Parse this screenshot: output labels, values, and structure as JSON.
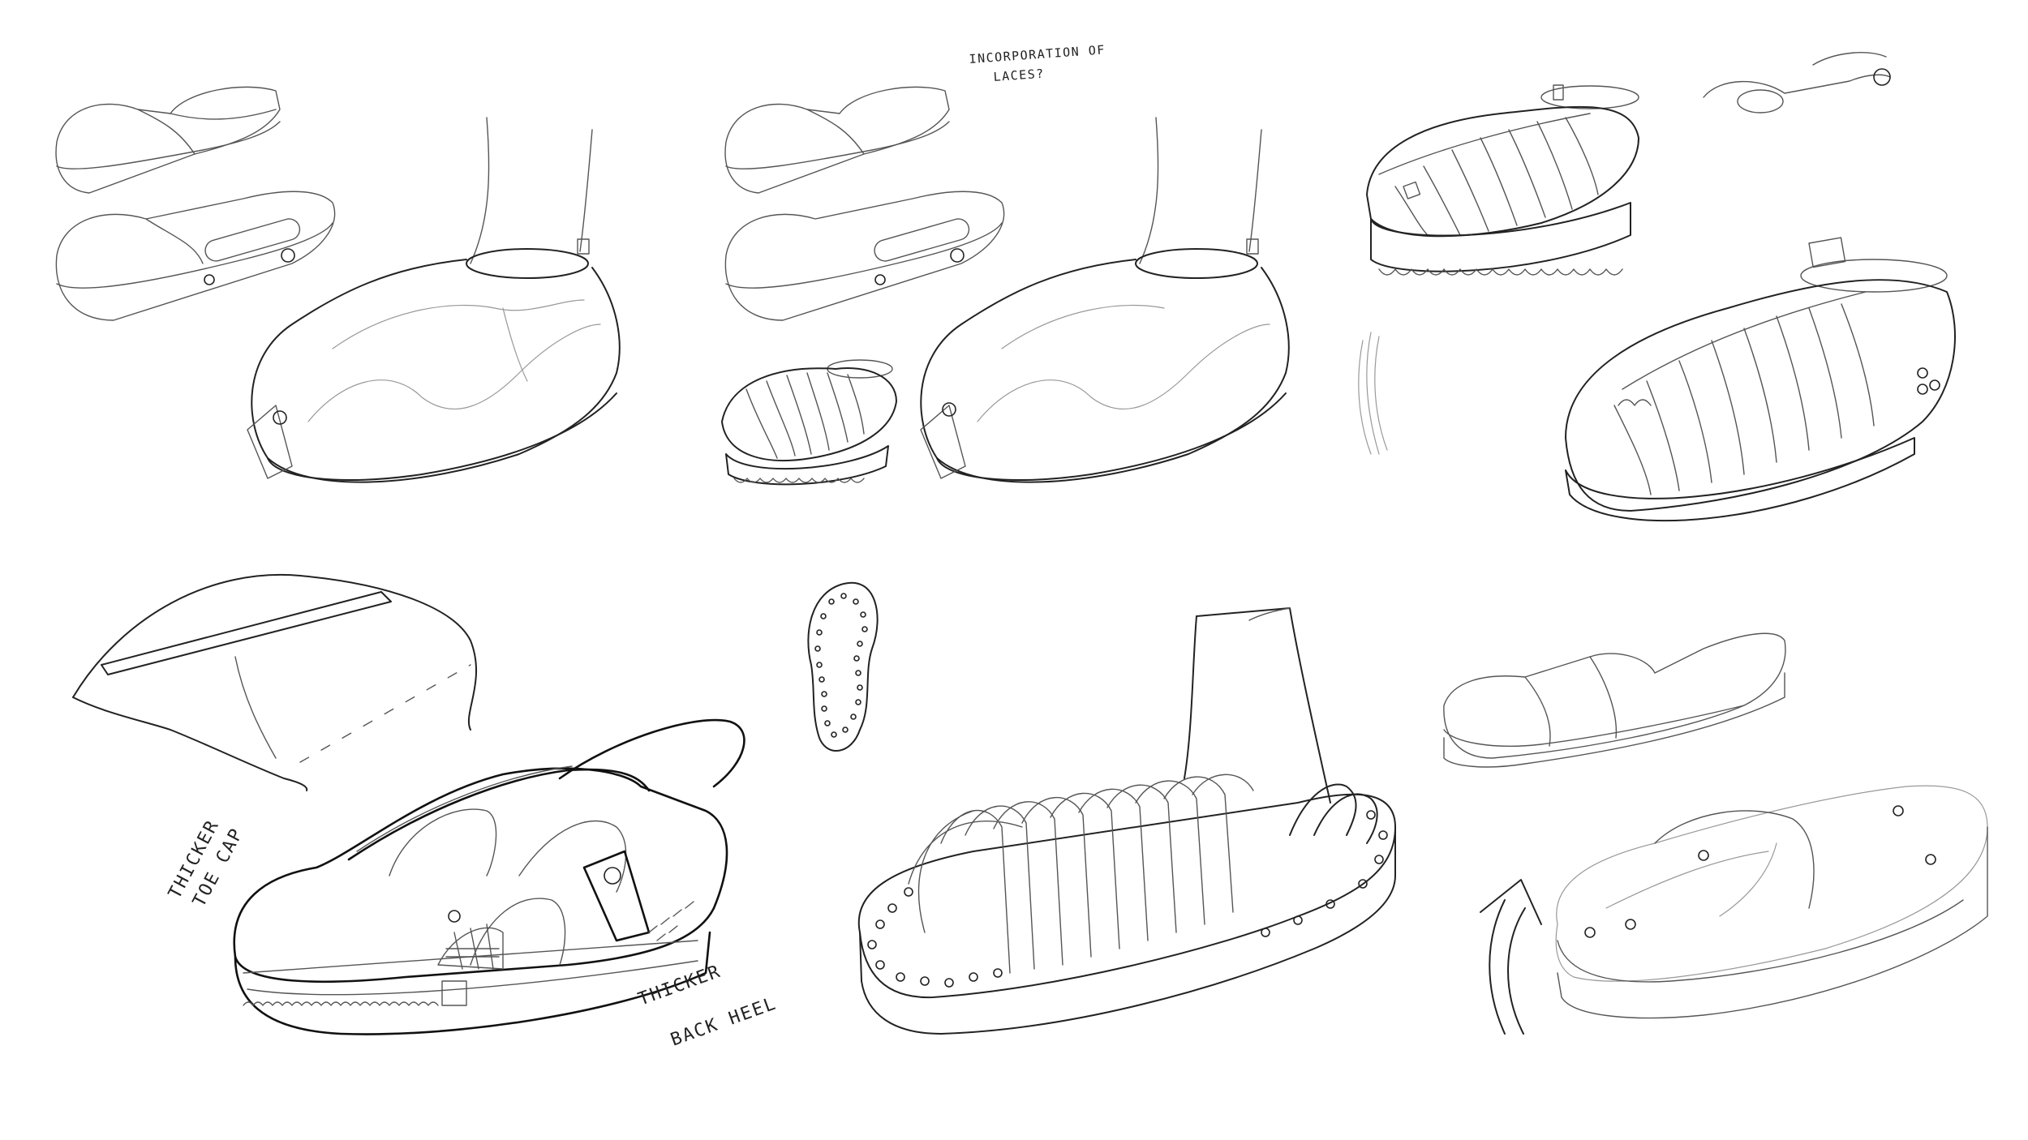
{
  "annotations": {
    "laces_note_line1": "INCORPORATION OF",
    "laces_note_line2": "LACES?",
    "toe_cap_line1": "THICKER",
    "toe_cap_line2": "TOE CAP",
    "back_heel_line1": "THICKER",
    "back_heel_line2": "BACK HEEL"
  }
}
